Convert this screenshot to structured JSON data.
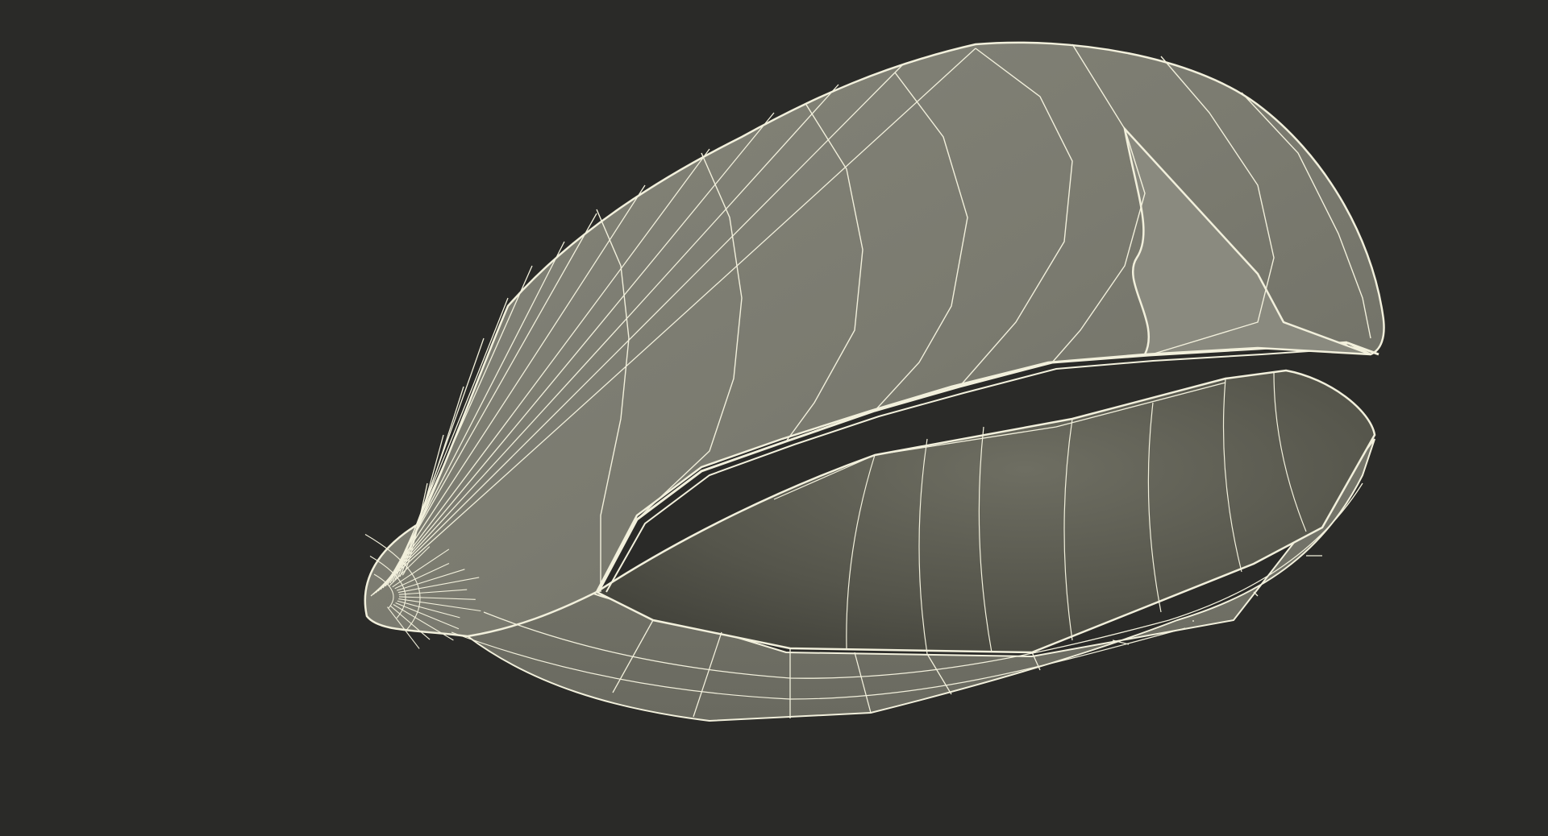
{
  "scene": {
    "subject": "seed-shell-wireframe-model",
    "colors": {
      "background": "#2a2a28",
      "shell_outer": "#7c7c70",
      "shell_inner_dark": "#4a4a42",
      "shell_inner_mid": "#666659",
      "wire": "#f2f0dc"
    }
  }
}
